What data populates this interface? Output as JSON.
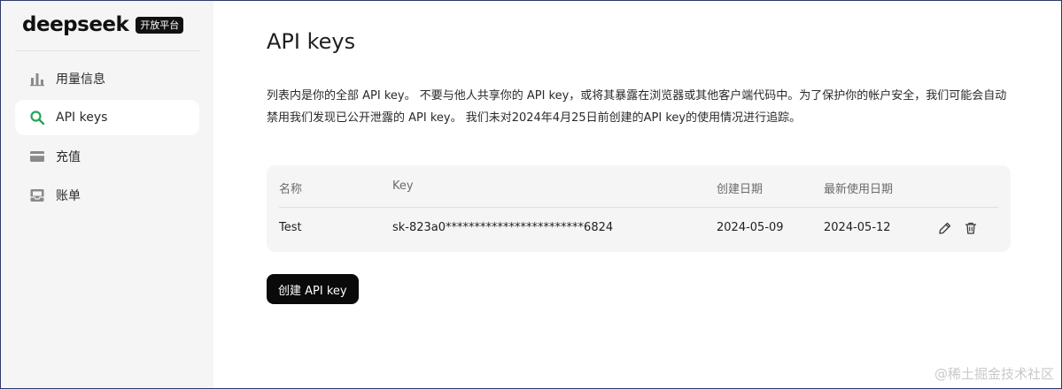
{
  "brand": {
    "logo": "deepseek",
    "badge": "开放平台"
  },
  "sidebar": {
    "items": [
      {
        "label": "用量信息",
        "icon": "bar-chart-icon",
        "active": false
      },
      {
        "label": "API keys",
        "icon": "search-icon",
        "active": true
      },
      {
        "label": "充值",
        "icon": "card-icon",
        "active": false
      },
      {
        "label": "账单",
        "icon": "inbox-icon",
        "active": false
      }
    ]
  },
  "main": {
    "title": "API keys",
    "description": "列表内是你的全部 API key。 不要与他人共享你的 API key，或将其暴露在浏览器或其他客户端代码中。为了保护你的帐户安全，我们可能会自动禁用我们发现已公开泄露的 API key。 我们未对2024年4月25日前创建的API key的使用情况进行追踪。",
    "table": {
      "headers": {
        "name": "名称",
        "key": "Key",
        "created": "创建日期",
        "last_used": "最新使用日期"
      },
      "rows": [
        {
          "name": "Test",
          "key": "sk-823a0************************6824",
          "created": "2024-05-09",
          "last_used": "2024-05-12",
          "actions": [
            "edit-icon",
            "trash-icon"
          ]
        }
      ]
    },
    "create_button": "创建 API key"
  },
  "watermark": "@稀土掘金技术社区",
  "colors": {
    "accent_active_icon": "#22a559",
    "sidebar_bg": "#f5f5f5",
    "button_bg": "#0a0a0a"
  }
}
